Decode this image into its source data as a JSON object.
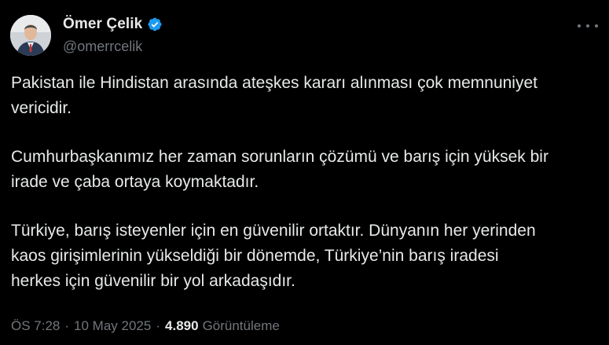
{
  "author": {
    "display_name": "Ömer Çelik",
    "handle": "@omerrcelik",
    "verified": true
  },
  "icons": {
    "verified": "verified-badge-icon",
    "more": "more-options-icon"
  },
  "colors": {
    "background": "#000000",
    "text": "#e7e9ea",
    "secondary": "#71767b",
    "verified_blue": "#1d9bf0"
  },
  "tweet": {
    "paragraphs": [
      [
        "Pakistan ile Hindistan arasında ateşkes kararı alınması çok memnuniyet",
        "vericidir."
      ],
      [
        "Cumhurbaşkanımız her zaman sorunların çözümü ve barış için yüksek bir",
        "irade ve çaba ortaya koymaktadır."
      ],
      [
        "Türkiye, barış isteyenler için en güvenilir ortaktır. Dünyanın her yerinden",
        "kaos girişimlerinin yükseldiği bir dönemde, Türkiye’nin barış iradesi",
        "herkes için güvenilir bir yol arkadaşıdır."
      ]
    ]
  },
  "meta": {
    "time": "ÖS 7:28",
    "separator": "·",
    "date": "10 May 2025",
    "views_count": "4.890",
    "views_label": "Görüntüleme"
  }
}
